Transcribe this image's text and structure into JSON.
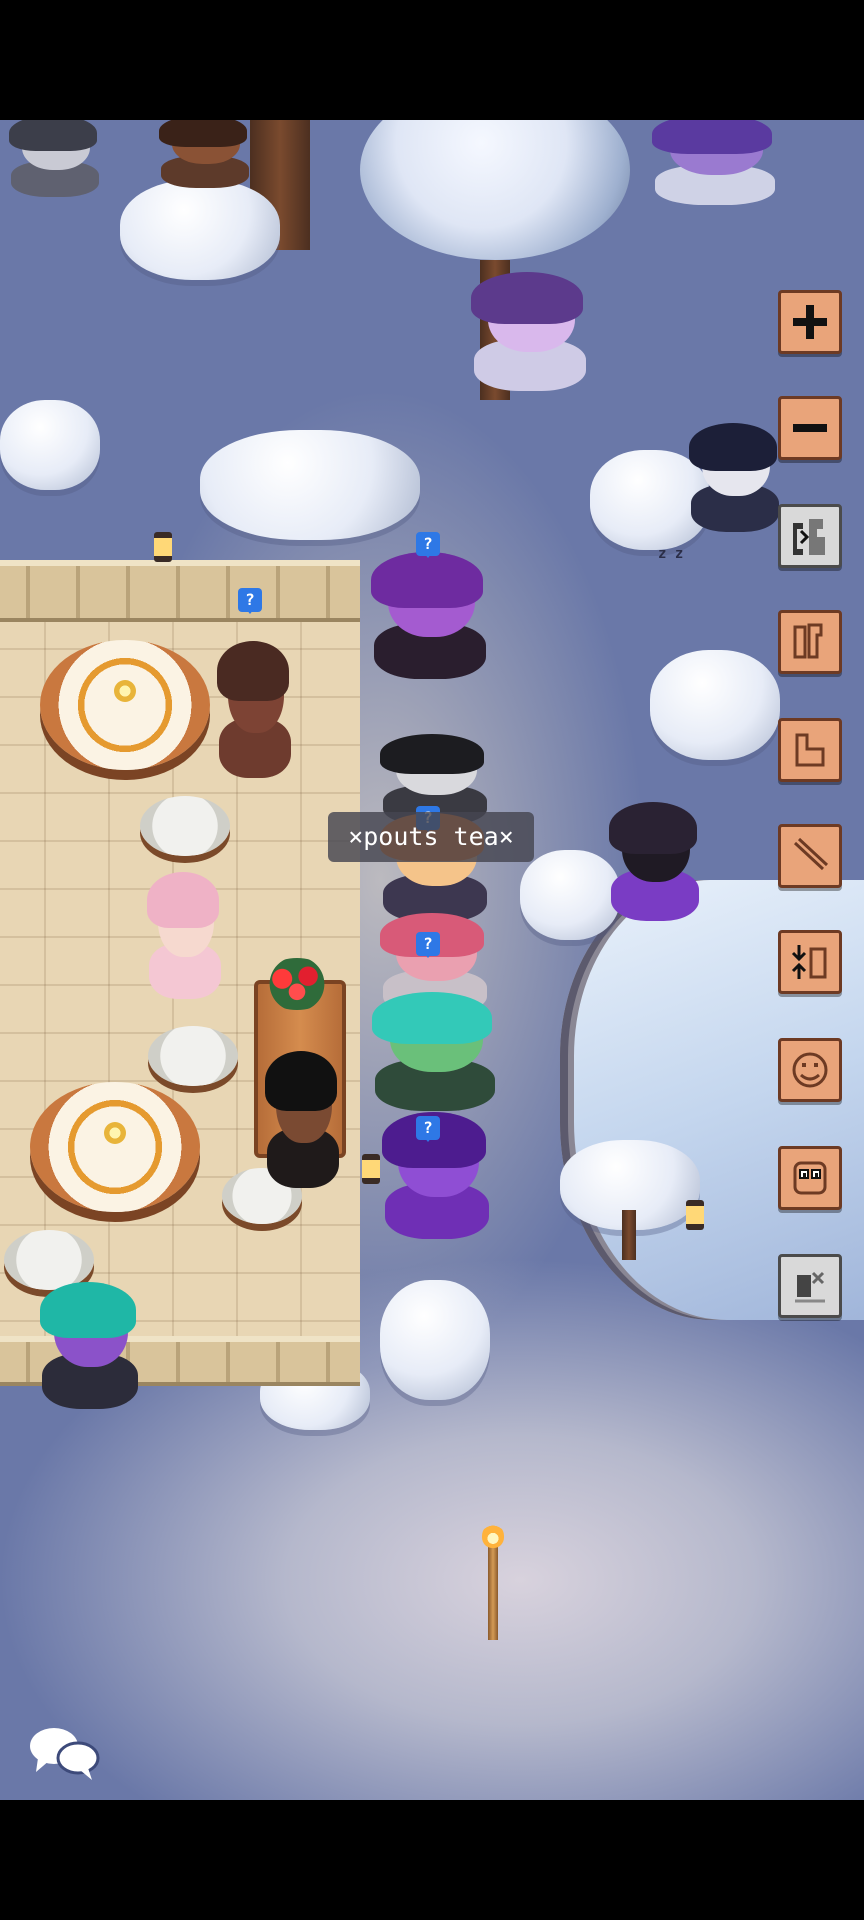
{
  "scene": {
    "name": "snowy forest café",
    "emote_bubble_text": "×pouts tea×",
    "snore_text": "z z"
  },
  "status_icons": [
    {
      "symbol": "?"
    },
    {
      "symbol": "?"
    },
    {
      "symbol": "?"
    },
    {
      "symbol": "?"
    },
    {
      "symbol": "?"
    }
  ],
  "toolbar": {
    "zoom_in_icon": "plus-icon",
    "zoom_out_icon": "minus-icon",
    "buttons": [
      {
        "name": "zoom-in-button",
        "icon": "plus-icon"
      },
      {
        "name": "zoom-out-button",
        "icon": "minus-icon"
      },
      {
        "name": "stand-button",
        "icon": "stand-pony-icon"
      },
      {
        "name": "sit-button",
        "icon": "sit-pony-icon"
      },
      {
        "name": "lie-button",
        "icon": "lie-pony-icon"
      },
      {
        "name": "fly-button",
        "icon": "fly-pony-icon"
      },
      {
        "name": "turn-head-button",
        "icon": "turn-head-icon"
      },
      {
        "name": "expression-button",
        "icon": "expression-face-icon"
      },
      {
        "name": "look-button",
        "icon": "look-face-icon"
      },
      {
        "name": "action-button",
        "icon": "action-icon"
      }
    ]
  },
  "chat": {
    "icon": "chat-bubbles-icon"
  },
  "colors": {
    "toolbar_button": "#e9a47a",
    "toolbar_border": "#6d3a23",
    "status_icon": "#2e78e6",
    "bubble_bg": "#464650"
  }
}
